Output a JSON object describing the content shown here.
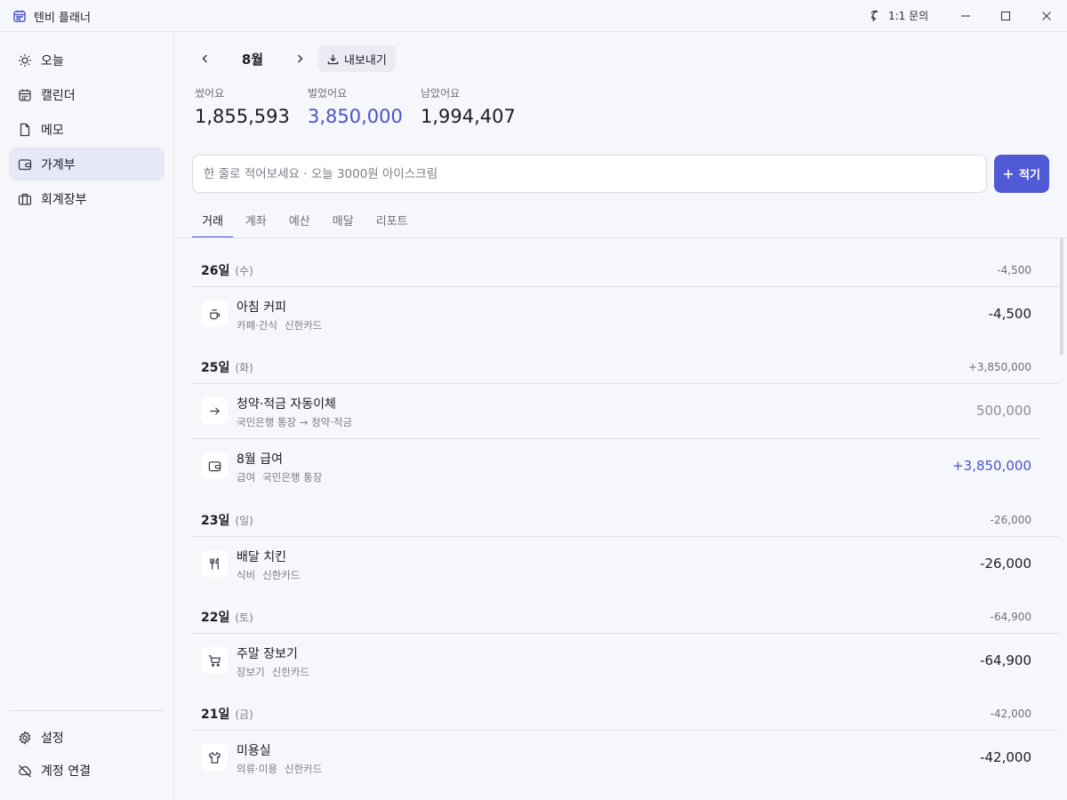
{
  "app": {
    "title": "텐비 플래너",
    "inquiry_label": "1:1 문의"
  },
  "sidebar": {
    "items": [
      {
        "label": "오늘",
        "icon": "sun-icon"
      },
      {
        "label": "캘린더",
        "icon": "calendar-icon"
      },
      {
        "label": "메모",
        "icon": "document-icon"
      },
      {
        "label": "가계부",
        "icon": "wallet-icon",
        "active": true
      },
      {
        "label": "회계장부",
        "icon": "briefcase-icon"
      }
    ],
    "bottom": [
      {
        "label": "설정",
        "icon": "gear-icon"
      },
      {
        "label": "계정 연결",
        "icon": "cloud-off-icon"
      }
    ]
  },
  "header": {
    "month": "8월",
    "export_label": "내보내기"
  },
  "summary": {
    "spent_label": "썼어요",
    "spent_value": "1,855,593",
    "earned_label": "벌었어요",
    "earned_value": "3,850,000",
    "left_label": "남았어요",
    "left_value": "1,994,407"
  },
  "quick_entry": {
    "placeholder": "한 줄로 적어보세요 · 오늘 3000원 아이스크림",
    "value": "",
    "add_label": "적기"
  },
  "tabs": [
    "거래",
    "계좌",
    "예산",
    "매달",
    "리포트"
  ],
  "days": [
    {
      "date": "26일",
      "dow": "(수)",
      "total": "-4,500",
      "transactions": [
        {
          "name": "아침 커피",
          "category": "카페·간식",
          "account": "신한카드",
          "amount": "-4,500",
          "kind": "expense",
          "icon": "coffee-icon"
        }
      ]
    },
    {
      "date": "25일",
      "dow": "(화)",
      "total": "+3,850,000",
      "transactions": [
        {
          "name": "청약·적금 자동이체",
          "category": "국민은행 통장 → 청약·적금",
          "account": "",
          "amount": "500,000",
          "kind": "transfer",
          "icon": "arrow-right-icon"
        },
        {
          "name": "8월 급여",
          "category": "급여",
          "account": "국민은행 통장",
          "amount": "+3,850,000",
          "kind": "income",
          "icon": "wallet-icon"
        }
      ]
    },
    {
      "date": "23일",
      "dow": "(일)",
      "total": "-26,000",
      "transactions": [
        {
          "name": "배달 치킨",
          "category": "식비",
          "account": "신한카드",
          "amount": "-26,000",
          "kind": "expense",
          "icon": "utensils-icon"
        }
      ]
    },
    {
      "date": "22일",
      "dow": "(토)",
      "total": "-64,900",
      "transactions": [
        {
          "name": "주말 장보기",
          "category": "장보기",
          "account": "신한카드",
          "amount": "-64,900",
          "kind": "expense",
          "icon": "cart-icon"
        }
      ]
    },
    {
      "date": "21일",
      "dow": "(금)",
      "total": "-42,000",
      "transactions": [
        {
          "name": "미용실",
          "category": "의류·미용",
          "account": "신한카드",
          "amount": "-42,000",
          "kind": "expense",
          "icon": "shirt-icon"
        }
      ]
    }
  ],
  "colors": {
    "accent": "#5059d6",
    "income": "#4a53c9",
    "transfer": "#8b8d99",
    "active_nav": "#e6e8f5"
  }
}
